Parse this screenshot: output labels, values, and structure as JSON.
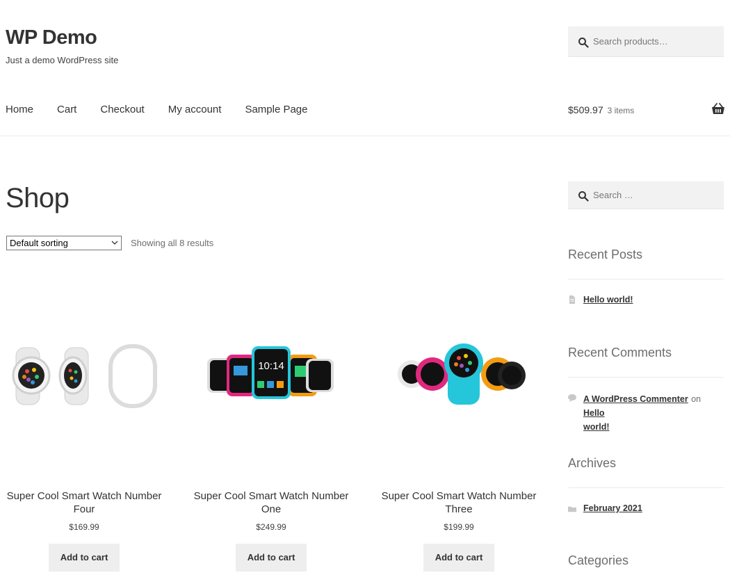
{
  "site": {
    "title": "WP Demo",
    "description": "Just a demo WordPress site"
  },
  "header_search": {
    "placeholder": "Search products…"
  },
  "nav": {
    "items": [
      {
        "label": "Home"
      },
      {
        "label": "Cart"
      },
      {
        "label": "Checkout"
      },
      {
        "label": "My account"
      },
      {
        "label": "Sample Page"
      }
    ]
  },
  "cart": {
    "total": "$509.97",
    "count": "3 items",
    "icon": "basket-icon"
  },
  "page": {
    "title": "Shop"
  },
  "toolbar": {
    "sorting_selected": "Default sorting",
    "result_count": "Showing all 8 results"
  },
  "products": [
    {
      "title_line1": "Super Cool Smart Watch Number",
      "title_line2": "Four",
      "price": "$169.99",
      "button": "Add to cart"
    },
    {
      "title_line1": "Super Cool Smart Watch Number",
      "title_line2": "One",
      "price": "$249.99",
      "button": "Add to cart"
    },
    {
      "title_line1": "Super Cool Smart Watch Number",
      "title_line2": "Three",
      "price": "$199.99",
      "button": "Add to cart"
    }
  ],
  "sidebar": {
    "search_placeholder": "Search …",
    "recent_posts": {
      "title": "Recent Posts",
      "items": [
        "Hello world!"
      ]
    },
    "recent_comments": {
      "title": "Recent Comments",
      "author": "A WordPress Commenter",
      "joiner": "on",
      "post_line1": "Hello",
      "post_line2": "world!"
    },
    "archives": {
      "title": "Archives",
      "items": [
        "February 2021"
      ]
    },
    "categories": {
      "title": "Categories"
    }
  },
  "colors": {
    "background": "#ffffff",
    "text": "#333333",
    "muted": "#6d6d6d",
    "button_bg": "#eeeeee",
    "search_bg": "#f2f2f2"
  }
}
